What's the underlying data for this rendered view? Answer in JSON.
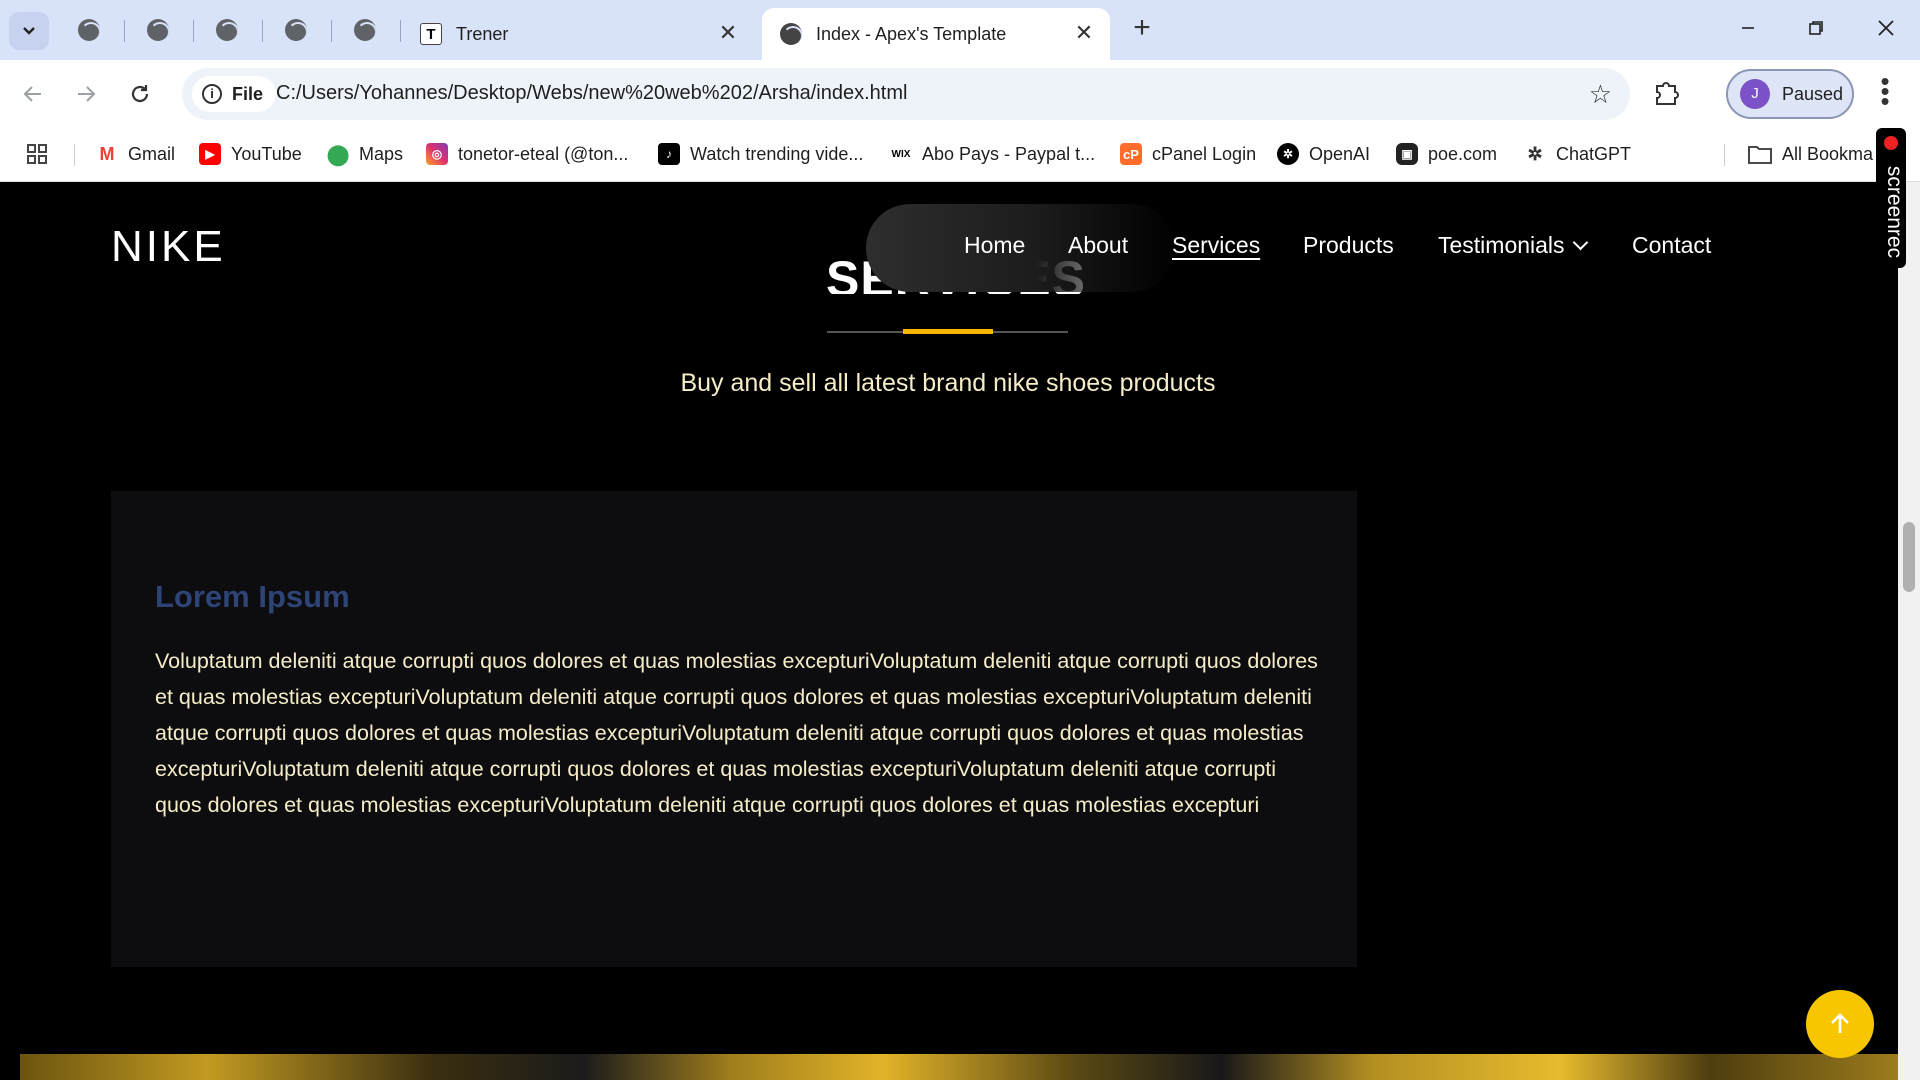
{
  "browser": {
    "tabs": [
      {
        "title": "Trener",
        "active": false
      },
      {
        "title": "Index - Apex's Template",
        "active": true
      }
    ],
    "address": {
      "chip_label": "File",
      "url": "C:/Users/Yohannes/Desktop/Webs/new%20web%202/Arsha/index.html"
    },
    "profile": {
      "initial": "J",
      "status": "Paused"
    },
    "bookmarks": [
      {
        "label": "Gmail",
        "icon": "gmail-icon"
      },
      {
        "label": "YouTube",
        "icon": "youtube-icon"
      },
      {
        "label": "Maps",
        "icon": "maps-icon"
      },
      {
        "label": "tonetor-eteal (@ton...",
        "icon": "instagram-icon"
      },
      {
        "label": "Watch trending vide...",
        "icon": "tiktok-icon"
      },
      {
        "label": "Abo Pays - Paypal t...",
        "icon": "wix-icon"
      },
      {
        "label": "cPanel Login",
        "icon": "cpanel-icon"
      },
      {
        "label": "OpenAI",
        "icon": "openai-icon"
      },
      {
        "label": "poe.com",
        "icon": "poe-icon"
      },
      {
        "label": "ChatGPT",
        "icon": "chatgpt-icon"
      }
    ],
    "all_bookmarks": "All Bookma",
    "recorder_label": "screenrec"
  },
  "site": {
    "logo": "NIKE",
    "nav": [
      "Home",
      "About",
      "Services",
      "Products",
      "Testimonials",
      "Contact"
    ],
    "active_nav": "Services",
    "section_title": "SERVICES",
    "section_subtitle": "Buy and sell all latest brand nike shoes products",
    "card": {
      "title": "Lorem Ipsum",
      "body": "Voluptatum deleniti atque corrupti quos dolores et quas molestias excepturiVoluptatum deleniti atque corrupti quos dolores et quas molestias excepturiVoluptatum deleniti atque corrupti quos dolores et quas molestias excepturiVoluptatum deleniti atque corrupti quos dolores et quas molestias excepturiVoluptatum deleniti atque corrupti quos dolores et quas molestias excepturiVoluptatum deleniti atque corrupti quos dolores et quas molestias excepturiVoluptatum deleniti atque corrupti quos dolores et quas molestias excepturiVoluptatum deleniti atque corrupti quos dolores et quas molestias excepturi"
    }
  },
  "colors": {
    "accent": "#f7b500",
    "card_title": "#2e4476",
    "body_text": "#f5ecc8",
    "back_to_top": "#f7c600"
  }
}
